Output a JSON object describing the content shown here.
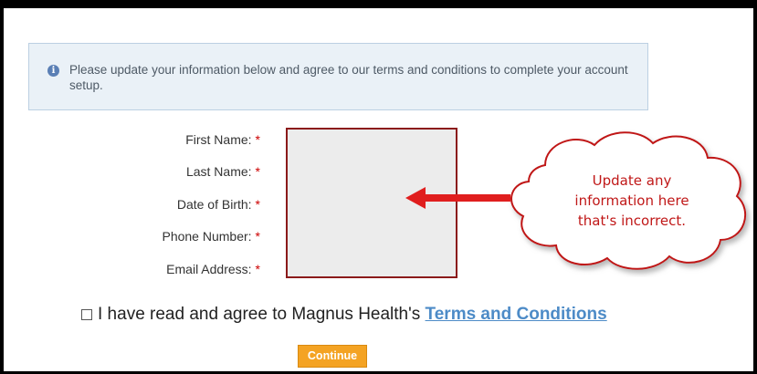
{
  "notice": {
    "icon": "info-icon",
    "text": "Please update your information below and agree to our terms and conditions to complete your account setup."
  },
  "form": {
    "required_marker": "*",
    "fields": [
      {
        "label": "First Name:"
      },
      {
        "label": "Last Name:"
      },
      {
        "label": "Date of Birth:"
      },
      {
        "label": "Phone Number:"
      },
      {
        "label": "Email Address:"
      }
    ]
  },
  "annotation": {
    "lines": [
      "Update any",
      "information here",
      "that's incorrect."
    ],
    "color": "#c01818"
  },
  "agreement": {
    "text": "I have read and agree to Magnus Health's",
    "link": "Terms and Conditions"
  },
  "continue_label": "Continue",
  "colors": {
    "accent_button": "#f4a323",
    "link": "#4d8bc7",
    "required": "#cc0000",
    "notice_bg": "#eaf1f7"
  }
}
